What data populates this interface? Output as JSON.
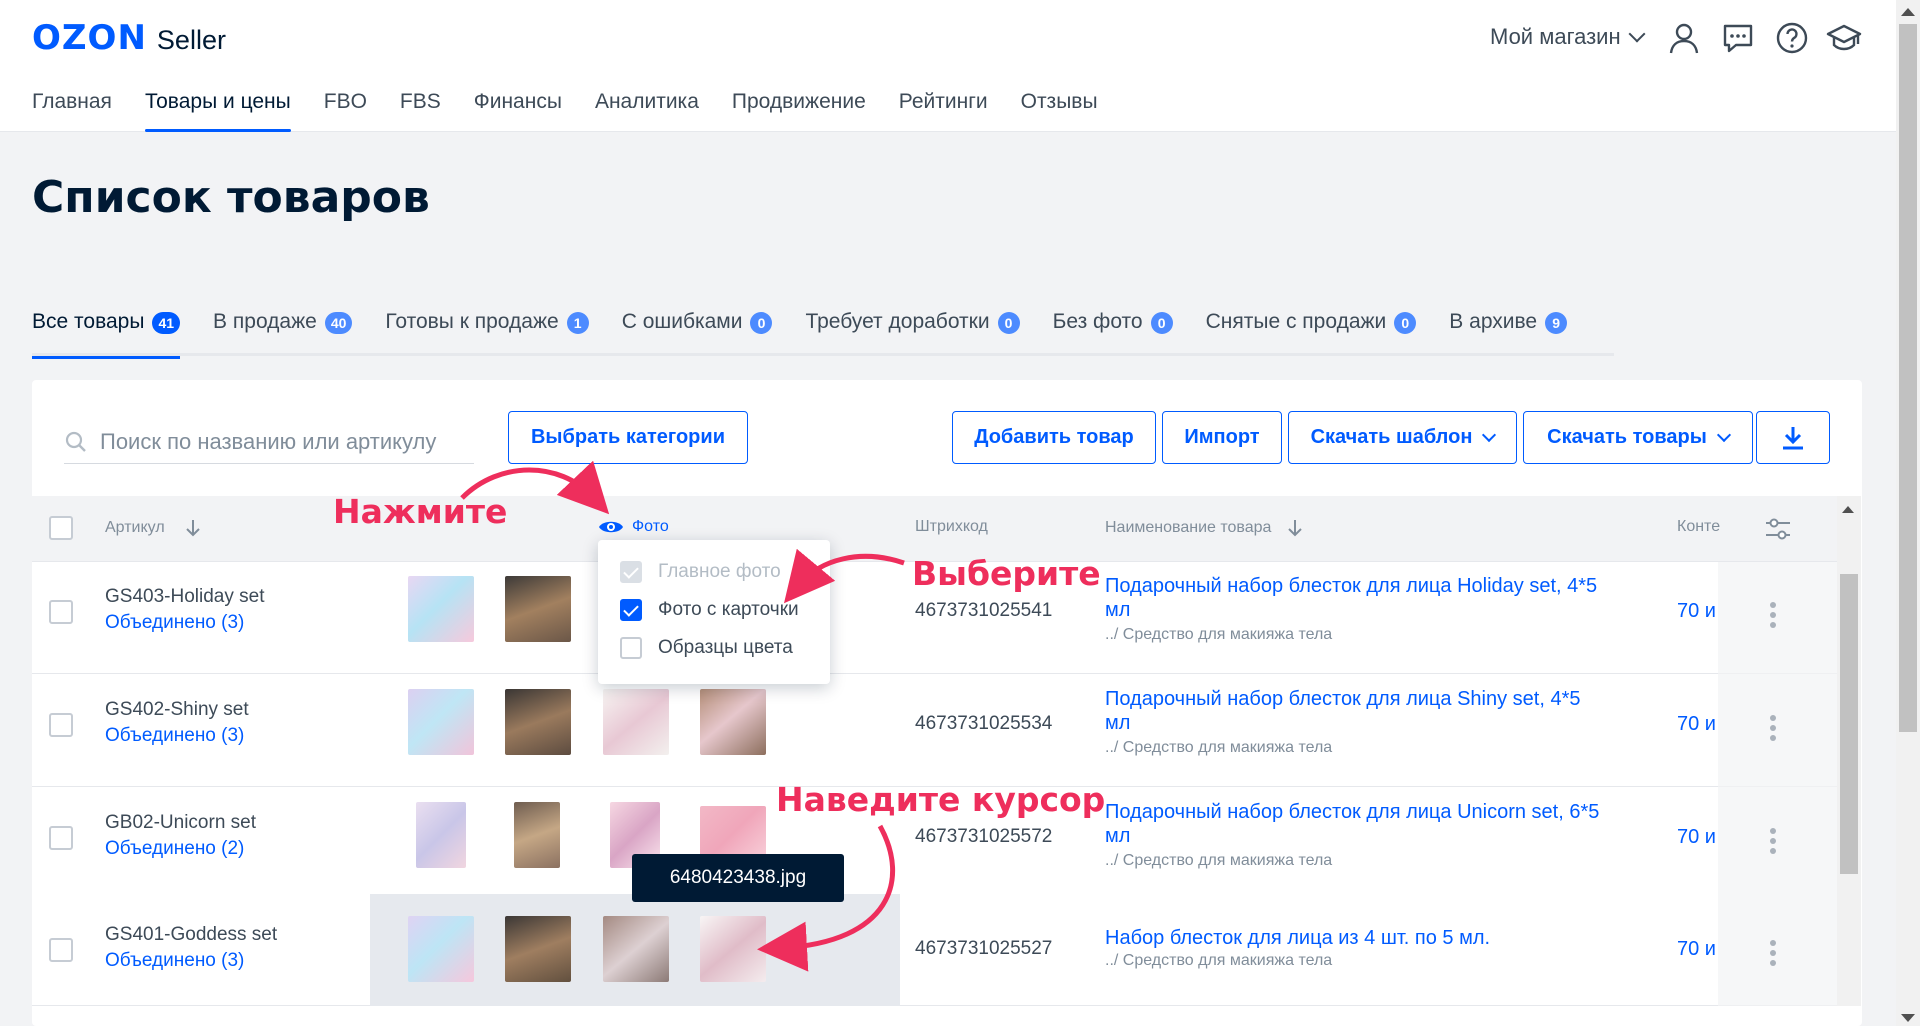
{
  "header": {
    "logo_brand": "OZON",
    "logo_product": "Seller",
    "shop_label": "Мой магазин",
    "nav": [
      "Главная",
      "Товары и цены",
      "FBO",
      "FBS",
      "Финансы",
      "Аналитика",
      "Продвижение",
      "Рейтинги",
      "Отзывы"
    ],
    "active_nav": 1
  },
  "page": {
    "title": "Список товаров"
  },
  "tabs": [
    {
      "label": "Все товары",
      "count": "41"
    },
    {
      "label": "В продаже",
      "count": "40"
    },
    {
      "label": "Готовы к продаже",
      "count": "1"
    },
    {
      "label": "С ошибками",
      "count": "0"
    },
    {
      "label": "Требует доработки",
      "count": "0"
    },
    {
      "label": "Без фото",
      "count": "0"
    },
    {
      "label": "Снятые с продажи",
      "count": "0"
    },
    {
      "label": "В архиве",
      "count": "9"
    }
  ],
  "toolbar": {
    "search_placeholder": "Поиск по названию или артикулу",
    "categories_btn": "Выбрать категории",
    "add_btn": "Добавить товар",
    "import_btn": "Импорт",
    "template_btn": "Скачать шаблон",
    "download_btn": "Скачать товары"
  },
  "table": {
    "col_article": "Артикул",
    "col_photo": "Фото",
    "col_barcode": "Штрихкод",
    "col_name": "Наименование товара",
    "col_content": "Конте",
    "rows": [
      {
        "article": "GS403-Holiday set",
        "joined": "Объединено (3)",
        "barcode": "4673731025541",
        "name_line1": "Подарочный набор блесток для лица Holiday set, 4*5",
        "name_line2": "мл",
        "category": "../ Средство для макияжа тела",
        "content": "70 и"
      },
      {
        "article": "GS402-Shiny set",
        "joined": "Объединено (3)",
        "barcode": "4673731025534",
        "name_line1": "Подарочный набор блесток для лица Shiny set, 4*5",
        "name_line2": "мл",
        "category": "../ Средство для макияжа тела",
        "content": "70 и"
      },
      {
        "article": "GB02-Unicorn set",
        "joined": "Объединено (2)",
        "barcode": "4673731025572",
        "name_line1": "Подарочный набор блесток для лица Unicorn set, 6*5",
        "name_line2": "мл",
        "category": "../ Средство для макияжа тела",
        "content": "70 и"
      },
      {
        "article": "GS401-Goddess set",
        "joined": "Объединено (3)",
        "barcode": "4673731025527",
        "name_line1": "Набор блесток для лица из 4 шт. по 5 мл.",
        "name_line2": "",
        "category": "../ Средство для макияжа тела",
        "content": "70 и"
      }
    ]
  },
  "photo_popup": {
    "items": [
      {
        "label": "Главное фото",
        "state": "disabled"
      },
      {
        "label": "Фото с карточки",
        "state": "checked"
      },
      {
        "label": "Образцы цвета",
        "state": "unchecked"
      }
    ]
  },
  "tooltip": "6480423438.jpg",
  "annotations": {
    "click": "Нажмите",
    "choose": "Выберите",
    "hover": "Наведите курсор"
  },
  "colors": {
    "accent": "#005bff",
    "annotation": "#ee2e5c",
    "text": "#001a34"
  }
}
